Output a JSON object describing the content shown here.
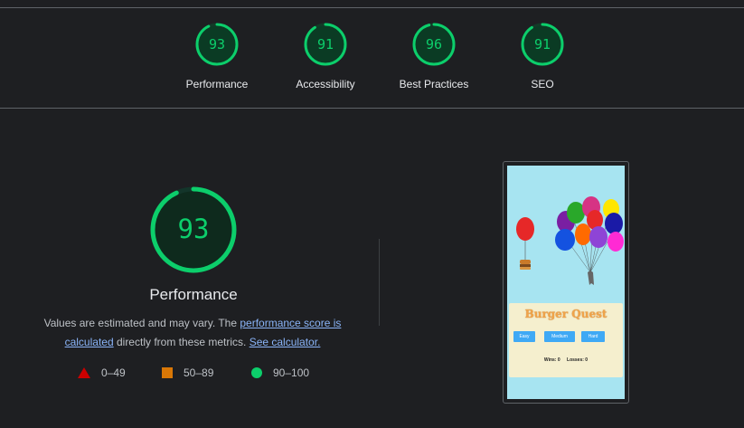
{
  "summary": {
    "gauges": [
      {
        "score": "93",
        "label": "Performance",
        "color": "#0cce6b"
      },
      {
        "score": "91",
        "label": "Accessibility",
        "color": "#0cce6b"
      },
      {
        "score": "96",
        "label": "Best Practices",
        "color": "#0cce6b"
      },
      {
        "score": "91",
        "label": "SEO",
        "color": "#0cce6b"
      }
    ]
  },
  "performance": {
    "score": "93",
    "score_value": 0.93,
    "title": "Performance",
    "desc_prefix": "Values are estimated and may vary. The ",
    "desc_link": "performance score is calculated",
    "desc_middle": " directly from these metrics. ",
    "desc_link2": "See calculator.",
    "legend": [
      {
        "range": "0–49",
        "color": "#cc0000",
        "icon": "triangle-icon"
      },
      {
        "range": "50–89",
        "color": "#d97706",
        "icon": "square-icon"
      },
      {
        "range": "90–100",
        "color": "#0cce6b",
        "icon": "circle-icon"
      }
    ]
  },
  "screenshot": {
    "game_title": "Burger Quest",
    "buttons": [
      "Easy",
      "Medium",
      "Hard"
    ],
    "wins": "Wins: 0",
    "losses": "Losses: 0"
  }
}
